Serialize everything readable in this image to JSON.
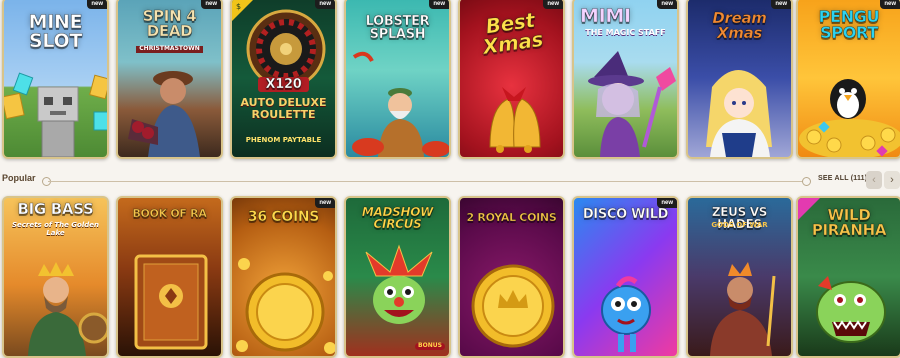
{
  "new_badge": "new",
  "featured": [
    {
      "title": "MINE SLOT",
      "sub": "",
      "extra": ""
    },
    {
      "title": "SPIN 4 DEAD",
      "sub": "CHRISTMASTOWN",
      "extra": ""
    },
    {
      "title": "x120",
      "sub": "Auto Deluxe ROULETTE",
      "extra": "PHENOM PAYTABLE"
    },
    {
      "title": "LOBSTER SPLASH",
      "sub": "",
      "extra": ""
    },
    {
      "title": "Best Xmas",
      "sub": "",
      "extra": ""
    },
    {
      "title": "MIMI",
      "sub": "THE MAGIC STAFF",
      "extra": ""
    },
    {
      "title": "Dream Xmas",
      "sub": "",
      "extra": ""
    },
    {
      "title": "PENGU SPORT",
      "sub": "",
      "extra": ""
    }
  ],
  "section": {
    "title": "Popular",
    "see_all": "SEE ALL (111)"
  },
  "popular": [
    {
      "title": "BIG BASS",
      "sub": "Secrets of The Golden Lake"
    },
    {
      "title": "BOOK OF RA",
      "sub": ""
    },
    {
      "title": "36 COINS",
      "sub": ""
    },
    {
      "title": "MADSHOW CIRCUS",
      "sub": "BONUS"
    },
    {
      "title": "2 ROYAL COINS",
      "sub": ""
    },
    {
      "title": "DISCO WILD",
      "sub": ""
    },
    {
      "title": "ZEUS vs HADES",
      "sub": "GODS OF WAR"
    },
    {
      "title": "WILD PIRANHA",
      "sub": ""
    }
  ]
}
